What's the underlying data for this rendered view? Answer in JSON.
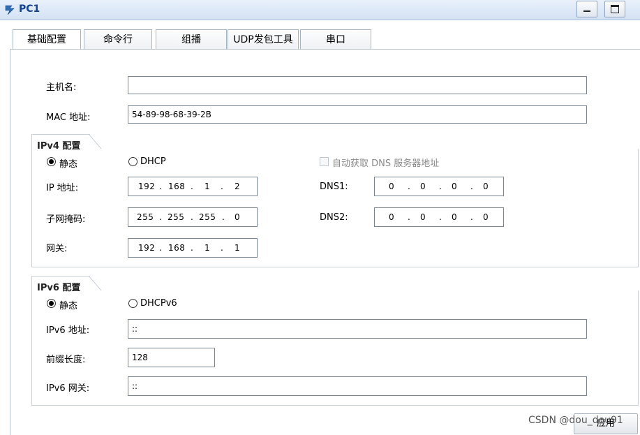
{
  "window": {
    "title": "PC1"
  },
  "tabs": [
    {
      "label": "基础配置",
      "active": true
    },
    {
      "label": "命令行",
      "active": false
    },
    {
      "label": "组播",
      "active": false
    },
    {
      "label": "UDP发包工具",
      "active": false
    },
    {
      "label": "串口",
      "active": false
    }
  ],
  "basic": {
    "hostname_label": "主机名:",
    "hostname_value": "",
    "mac_label": "MAC 地址:",
    "mac_value": "54-89-98-68-39-2B"
  },
  "ipv4": {
    "title": "IPv4 配置",
    "static_label": "静态",
    "dhcp_label": "DHCP",
    "mode": "static",
    "auto_dns_label": "自动获取 DNS 服务器地址",
    "auto_dns_checked": false,
    "ip_label": "IP 地址:",
    "ip": [
      "192",
      "168",
      "1",
      "2"
    ],
    "mask_label": "子网掩码:",
    "mask": [
      "255",
      "255",
      "255",
      "0"
    ],
    "gateway_label": "网关:",
    "gateway": [
      "192",
      "168",
      "1",
      "1"
    ],
    "dns1_label": "DNS1:",
    "dns1": [
      "0",
      "0",
      "0",
      "0"
    ],
    "dns2_label": "DNS2:",
    "dns2": [
      "0",
      "0",
      "0",
      "0"
    ]
  },
  "ipv6": {
    "title": "IPv6 配置",
    "static_label": "静态",
    "dhcp_label": "DHCPv6",
    "mode": "static",
    "addr_label": "IPv6 地址:",
    "addr_value": "::",
    "prefix_label": "前缀长度:",
    "prefix_value": "128",
    "gateway_label": "IPv6 网关:",
    "gateway_value": "::"
  },
  "footer": {
    "apply_label": "应用",
    "watermark": "CSDN @dou_dou91"
  },
  "colors": {
    "titlebar": "#d3e2f4",
    "title_text": "#15428b",
    "border": "#7a8594"
  }
}
